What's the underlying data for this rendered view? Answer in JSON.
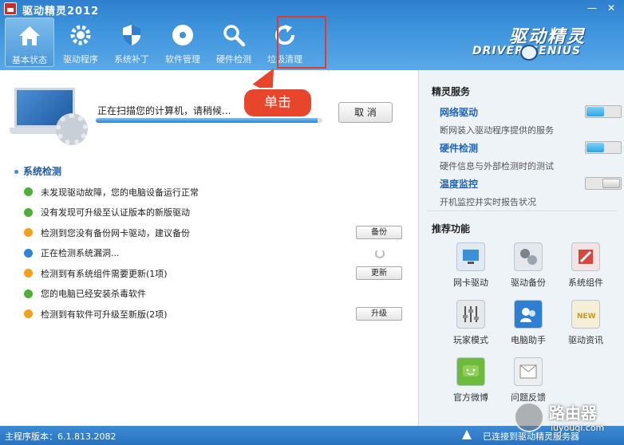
{
  "app": {
    "title": "驱动精灵2012",
    "window_buttons": {
      "minimize": "—",
      "close": "✕"
    }
  },
  "nav": [
    {
      "label": "基本状态",
      "icon": "home-icon",
      "active": true
    },
    {
      "label": "驱动程序",
      "icon": "gear-icon"
    },
    {
      "label": "系统补丁",
      "icon": "shield-icon"
    },
    {
      "label": "软件管理",
      "icon": "disc-icon"
    },
    {
      "label": "硬件检测",
      "icon": "magnifier-icon"
    },
    {
      "label": "垃圾清理",
      "icon": "refresh-icon"
    }
  ],
  "brand": {
    "cn": "驱动精灵",
    "en": "DRIVER GENIUS"
  },
  "scan": {
    "text": "正在扫描您的计算机，请稍候...",
    "progress": 0.98,
    "cancel_label": "取 消"
  },
  "callout": {
    "text": "单击"
  },
  "checks": {
    "title": "系统检测",
    "items": [
      {
        "status": "green",
        "text": "未发现驱动故障，您的电脑设备运行正常"
      },
      {
        "status": "green",
        "text": "没有发现可升级至认证版本的新版驱动"
      },
      {
        "status": "orange",
        "text": "检测到您没有备份网卡驱动，建议备份",
        "button": "备份"
      },
      {
        "status": "blue",
        "text": "正在检测系统漏洞...",
        "spinner": true
      },
      {
        "status": "orange",
        "text": "检测到有系统组件需要更新(1项)",
        "button": "更新"
      },
      {
        "status": "green",
        "text": "您的电脑已经安装杀毒软件"
      },
      {
        "status": "orange",
        "text": "检测到有软件可升级至新版(2项)",
        "button": "升级"
      }
    ]
  },
  "right": {
    "features_title": "精灵服务",
    "features": [
      {
        "name": "网络驱动",
        "desc": "断网装入驱动程序提供的服务",
        "on": true
      },
      {
        "name": "硬件检测",
        "desc": "硬件信息与外部检测时的测试",
        "on": true
      },
      {
        "name": "温度监控",
        "desc": "开机监控并实时报告状况",
        "on": false
      }
    ],
    "tools_title": "推荐功能",
    "tools": [
      {
        "label": "网卡驱动",
        "icon": "network-card-icon",
        "bg": "#3c8fd9"
      },
      {
        "label": "驱动备份",
        "icon": "backup-icon",
        "bg": "#9aa4ae"
      },
      {
        "label": "系统组件",
        "icon": "components-icon",
        "bg": "#d8473d"
      },
      {
        "label": "玩家模式",
        "icon": "sliders-icon",
        "bg": "#8a8f95"
      },
      {
        "label": "电脑助手",
        "icon": "assistant-icon",
        "bg": "#2e7fd1"
      },
      {
        "label": "驱动资讯",
        "icon": "news-icon",
        "bg": "#e8c66a"
      },
      {
        "label": "官方微博",
        "icon": "weibo-icon",
        "bg": "#6dbb3c"
      },
      {
        "label": "问题反馈",
        "icon": "feedback-icon",
        "bg": "#c6cbd0"
      }
    ]
  },
  "statusbar": {
    "version": "主程序版本：6.1.813.2082",
    "connection": "已连接到驱动精灵服务器"
  },
  "watermark": {
    "cn": "路由器",
    "en": "luyouqi.com"
  }
}
